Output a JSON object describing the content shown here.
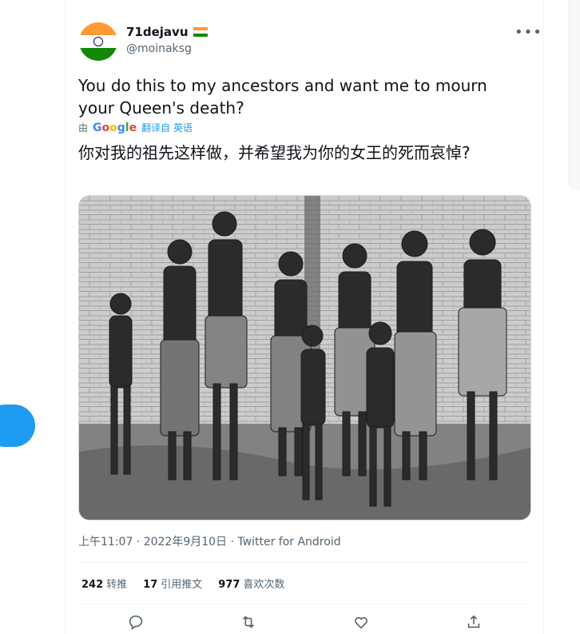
{
  "user": {
    "display_name": "71dejavu",
    "handle": "@moinaksg"
  },
  "tweet": {
    "text": "You do this to my ancestors and want me to mourn your Queen's death?",
    "translate_prefix": "由",
    "translate_provider": "Google",
    "translate_link": "翻译自 英语",
    "translated_text": "你对我的祖先这样做，并希望我为你的女王的死而哀悼?"
  },
  "meta": {
    "line": "上午11:07 · 2022年9月10日 · Twitter for Android"
  },
  "stats": {
    "retweets_count": "242",
    "retweets_label": "转推",
    "quotes_count": "17",
    "quotes_label": "引用推文",
    "likes_count": "977",
    "likes_label": "喜欢次数"
  },
  "colors": {
    "accent": "#1d9bf0",
    "secondary_text": "#536471"
  },
  "icons": [
    "more-icon",
    "reply-icon",
    "retweet-icon",
    "like-icon",
    "share-icon"
  ]
}
